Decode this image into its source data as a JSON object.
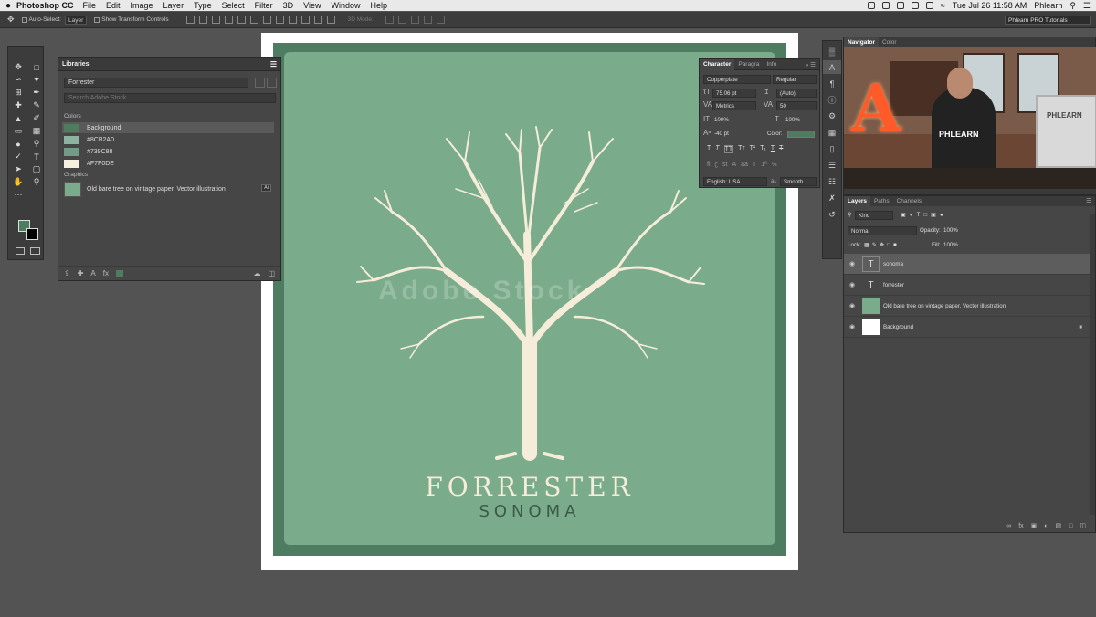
{
  "menubar": {
    "app_name": "Photoshop CC",
    "items": [
      "File",
      "Edit",
      "Image",
      "Layer",
      "Type",
      "Select",
      "Filter",
      "3D",
      "View",
      "Window",
      "Help"
    ],
    "clock": "Tue Jul 26  11:58 AM",
    "user": "Phlearn"
  },
  "options_bar": {
    "auto_select_label": "Auto-Select:",
    "auto_select_value": "Layer",
    "transform_label": "Show Transform Controls",
    "mode_3d_label": "3D Mode:",
    "workspace": "Phlearn PRO Tutorials"
  },
  "artwork": {
    "title": "FORRESTER",
    "subtitle": "SONOMA",
    "watermark": "Adobe Stock"
  },
  "libraries": {
    "title": "Libraries",
    "library_name": "Forrester",
    "search_placeholder": "Search Adobe Stock",
    "colors_label": "Colors",
    "colors": [
      {
        "name": "Background",
        "hex": "#4E7C5F"
      },
      {
        "name": "#8CB2A0",
        "hex": "#8CB2A0"
      },
      {
        "name": "#739C88",
        "hex": "#739C88"
      },
      {
        "name": "#F7F0DE",
        "hex": "#F7F0DE"
      }
    ],
    "graphics_label": "Graphics",
    "graphic_name": "Old bare tree on vintage paper. Vector illustration",
    "graphic_badge": "Ai"
  },
  "character": {
    "tabs": [
      "Character",
      "Paragra",
      "Info"
    ],
    "font_family": "Copperplate",
    "font_style": "Regular",
    "font_size": "75.06 pt",
    "leading": "(Auto)",
    "kerning": "Metrics",
    "tracking": "50",
    "vertical_scale": "100%",
    "horizontal_scale": "100%",
    "baseline_shift": "-40 pt",
    "color_label": "Color:",
    "language": "English: USA",
    "antialias_label": "aₐ",
    "antialias": "Smooth"
  },
  "navigator": {
    "tabs": [
      "Navigator",
      "Color"
    ],
    "shirt_text": "PHLEARN",
    "monitor_text": "PHLEARN"
  },
  "layers": {
    "tabs": [
      "Layers",
      "Paths",
      "Channels"
    ],
    "filter": "Kind",
    "blend_mode": "Normal",
    "opacity_label": "Opacity:",
    "opacity": "100%",
    "lock_label": "Lock:",
    "fill_label": "Fill:",
    "fill": "100%",
    "items": [
      {
        "name": "sonoma",
        "kind": "text"
      },
      {
        "name": "forrester",
        "kind": "text"
      },
      {
        "name": "Old bare tree on vintage paper. Vector illustration",
        "kind": "smart"
      },
      {
        "name": "Background",
        "kind": "fill"
      }
    ]
  }
}
